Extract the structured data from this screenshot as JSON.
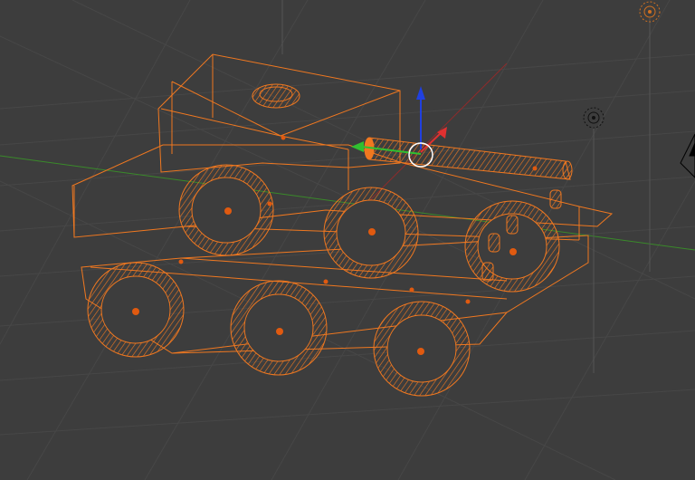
{
  "viewport": {
    "name": "3D Viewport",
    "shading": "wireframe",
    "background": "#3d3d3d"
  },
  "colors": {
    "selected_wire": "#f07820",
    "grid": "#474747",
    "x_axis": "#8e2b2b",
    "y_axis": "#3a8a2a",
    "gizmo_x": "#e03030",
    "gizmo_y": "#30c030",
    "gizmo_z": "#2040e0",
    "origin_dot": "#e05a10"
  },
  "scene": {
    "selected_object": "tank",
    "gizmo": "translate-manipulator",
    "other_objects": [
      "lamp-icon",
      "camera-icon",
      "empty-target-icon"
    ]
  }
}
